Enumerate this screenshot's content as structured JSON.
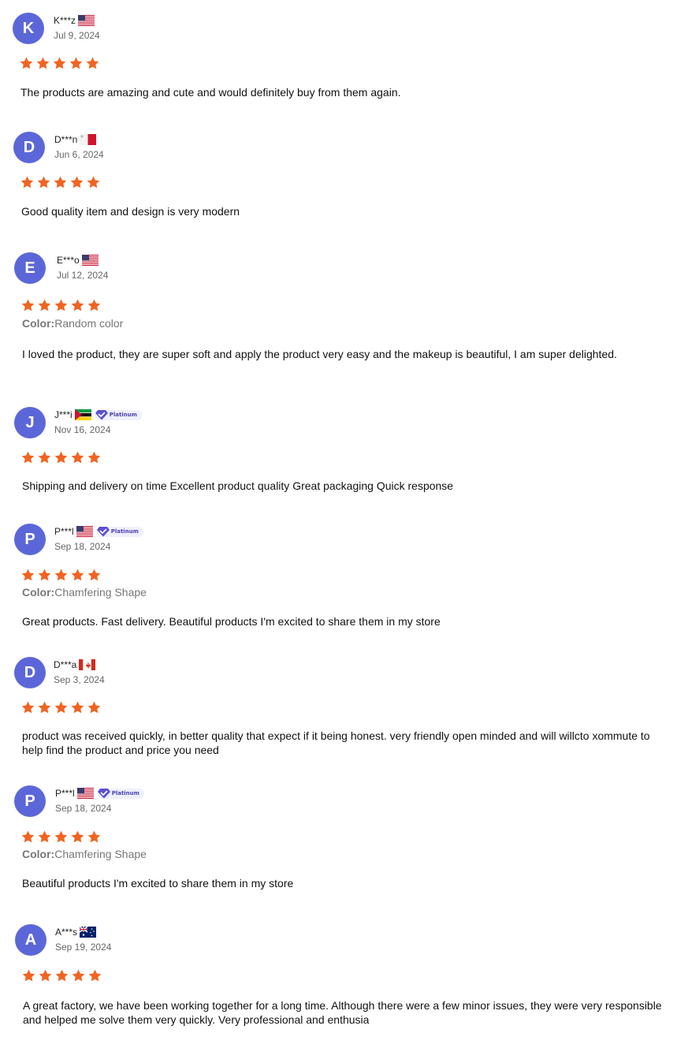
{
  "colors": {
    "avatar": "#5b67d8",
    "star": "#f06422",
    "badge_text": "#4c3fb0"
  },
  "variant_label": "Color:",
  "reviews": [
    {
      "initial": "K",
      "name": "K***z",
      "flag": "us",
      "badge": "",
      "date": "Jul 9, 2024",
      "rating": 5,
      "variant": "",
      "comment": "The products are amazing and cute and would definitely buy from them again."
    },
    {
      "initial": "D",
      "name": "D***n",
      "flag": "mt",
      "badge": "",
      "date": "Jun 6, 2024",
      "rating": 5,
      "variant": "",
      "comment": "Good quality item and design is very modern"
    },
    {
      "initial": "E",
      "name": "E***o",
      "flag": "us",
      "badge": "",
      "date": "Jul 12, 2024",
      "rating": 5,
      "variant": "Random color",
      "comment": "I loved the product, they are super soft and apply the product very easy and the makeup is beautiful, I am super delighted."
    },
    {
      "initial": "J",
      "name": "J***i",
      "flag": "mz",
      "badge": "Platinum",
      "date": "Nov 16, 2024",
      "rating": 5,
      "variant": "",
      "comment": "Shipping and delivery on time Excellent product quality Great packaging Quick response"
    },
    {
      "initial": "P",
      "name": "P***l",
      "flag": "us",
      "badge": "Platinum",
      "date": "Sep 18, 2024",
      "rating": 5,
      "variant": "Chamfering Shape",
      "comment": "Great products. Fast delivery. Beautiful products I'm excited to share them in my store"
    },
    {
      "initial": "D",
      "name": "D***a",
      "flag": "ca",
      "badge": "",
      "date": "Sep 3, 2024",
      "rating": 5,
      "variant": "",
      "comment": "product was received quickly, in better quality that expect if it being honest. very friendly open minded and will willcto xommute to help find the product and price you need"
    },
    {
      "initial": "P",
      "name": "P***l",
      "flag": "us",
      "badge": "Platinum",
      "date": "Sep 18, 2024",
      "rating": 5,
      "variant": "Chamfering Shape",
      "comment": "Beautiful products I'm excited to share them in my store"
    },
    {
      "initial": "A",
      "name": "A***s",
      "flag": "au",
      "badge": "",
      "date": "Sep 19, 2024",
      "rating": 5,
      "variant": "",
      "comment": "A great factory, we have been working together for a long time. Although there were a few minor issues, they were very responsible and helped me solve them very quickly. Very professional and enthusia"
    }
  ]
}
